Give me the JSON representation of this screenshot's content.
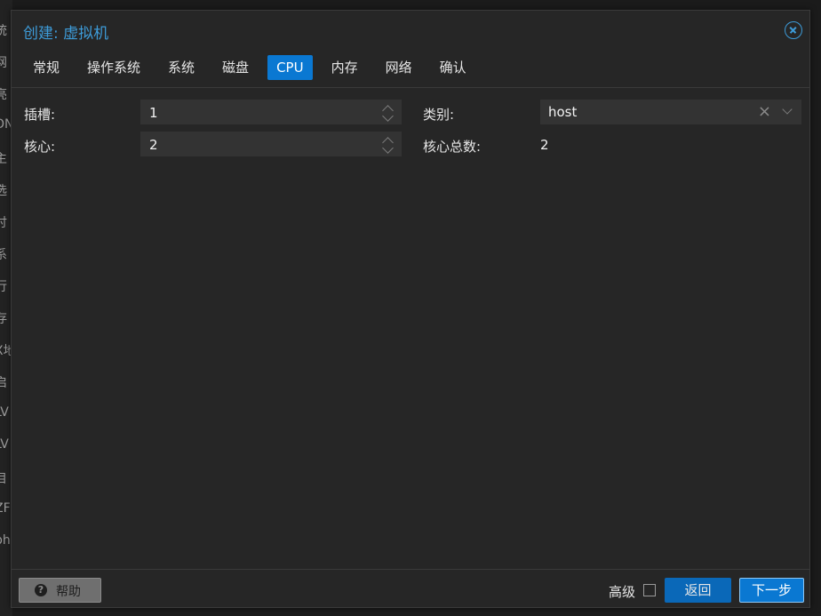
{
  "background_sidebar": [
    "统",
    "网",
    "亮",
    "ON",
    "主",
    "选",
    "讨",
    "系",
    "行",
    "存",
    "X地",
    "启",
    "LV",
    "LV",
    "目",
    "ZF",
    "ph"
  ],
  "dialog": {
    "title": "创建: 虚拟机",
    "tabs": [
      {
        "label": "常规",
        "active": false
      },
      {
        "label": "操作系统",
        "active": false
      },
      {
        "label": "系统",
        "active": false
      },
      {
        "label": "磁盘",
        "active": false
      },
      {
        "label": "CPU",
        "active": true
      },
      {
        "label": "内存",
        "active": false
      },
      {
        "label": "网络",
        "active": false
      },
      {
        "label": "确认",
        "active": false
      }
    ],
    "fields": {
      "sockets_label": "插槽:",
      "sockets_value": "1",
      "cores_label": "核心:",
      "cores_value": "2",
      "type_label": "类别:",
      "type_value": "host",
      "total_cores_label": "核心总数:",
      "total_cores_value": "2"
    },
    "footer": {
      "help_label": "帮助",
      "advanced_label": "高级",
      "back_label": "返回",
      "next_label": "下一步"
    }
  },
  "colors": {
    "accent": "#0a78d2",
    "title": "#3d9bd8"
  }
}
